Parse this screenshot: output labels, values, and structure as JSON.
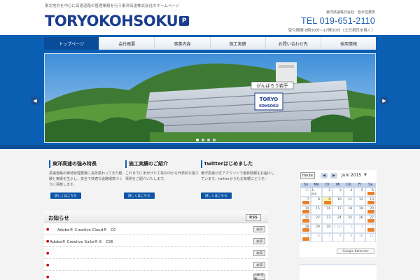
{
  "header": {
    "tagline": "東北地方を中心に高速道路の管理業務を行う東洋高速株式会社のホームページ",
    "logo_text": "TORYOKOHSOKU",
    "logo_mark": "P",
    "company_line": "東洋高速株式会社　岩手営業所",
    "tel": "TEL 019-651-2110",
    "hours": "受付時間 8時30分~17時30分（土日祝日を除く）"
  },
  "nav": {
    "items": [
      "トップページ",
      "会社概要",
      "事業内容",
      "施工実績",
      "お問い合わせ先",
      "採用情報"
    ]
  },
  "slider": {
    "sign_text": "がんばろう岩手",
    "building_logo_line1": "TORYO",
    "building_logo_line2": "KOHSOKU"
  },
  "boxes": [
    {
      "title": "東洋高速の強み特長",
      "text": "高速道路の維持管理業務に長年携わってきた経験と実績を生かし、安全で快適な道路環境づくりに貢献します。",
      "button": "詳しくはこちら"
    },
    {
      "title": "施工実績のご紹介",
      "text": "これまでに手がけた工事の中から代表的な施工事例をご紹介いたします。",
      "button": "詳しくはこちら"
    },
    {
      "title": "twitterはじめました",
      "text": "東洋高速公式アカウントで最新情報をお届けしています。twitterからもお気軽にどうぞ。",
      "button": "詳しくはこちら"
    }
  ],
  "news": {
    "title": "お知らせ",
    "rss_label": "RSS",
    "items": [
      {
        "text": "　　Adobe® Creative Cloud®　CC",
        "badge": "お知"
      },
      {
        "text": "Adobe® Creative Suite® 6　CS6",
        "badge": "お知"
      },
      {
        "text": "",
        "badge": "お知"
      },
      {
        "text": "",
        "badge": "お知"
      },
      {
        "text": "",
        "badge": "CSR活動"
      }
    ]
  },
  "calendar": {
    "today_label": "Heute",
    "prev": "◀",
    "next": "▶",
    "month_label": "Juni 2015",
    "menu_arrow": "▼",
    "weekdays": [
      "So",
      "Mo",
      "Di",
      "Mi",
      "Do",
      "Fr",
      "Sa"
    ],
    "weeks": [
      [
        {
          "d": "31",
          "o": true,
          "e": false
        },
        {
          "d": "1. Jun",
          "o": false,
          "e": false
        },
        {
          "d": "2",
          "o": false,
          "e": false
        },
        {
          "d": "3",
          "o": false,
          "e": false
        },
        {
          "d": "4",
          "o": false,
          "e": false
        },
        {
          "d": "5",
          "o": false,
          "e": false
        },
        {
          "d": "6",
          "o": false,
          "e": true
        }
      ],
      [
        {
          "d": "7",
          "o": false,
          "e": true
        },
        {
          "d": "8",
          "o": false,
          "e": false
        },
        {
          "d": "9",
          "o": false,
          "e": true,
          "t": true
        },
        {
          "d": "10",
          "o": false,
          "e": false
        },
        {
          "d": "11",
          "o": false,
          "e": false
        },
        {
          "d": "12",
          "o": false,
          "e": false
        },
        {
          "d": "13",
          "o": false,
          "e": true
        }
      ],
      [
        {
          "d": "14",
          "o": false,
          "e": true
        },
        {
          "d": "15",
          "o": false,
          "e": false
        },
        {
          "d": "16",
          "o": false,
          "e": false
        },
        {
          "d": "17",
          "o": false,
          "e": false
        },
        {
          "d": "18",
          "o": false,
          "e": false
        },
        {
          "d": "19",
          "o": false,
          "e": false
        },
        {
          "d": "20",
          "o": false,
          "e": true
        }
      ],
      [
        {
          "d": "21",
          "o": false,
          "e": true
        },
        {
          "d": "22",
          "o": false,
          "e": false
        },
        {
          "d": "23",
          "o": false,
          "e": false
        },
        {
          "d": "24",
          "o": false,
          "e": false
        },
        {
          "d": "25",
          "o": false,
          "e": false
        },
        {
          "d": "26",
          "o": false,
          "e": false
        },
        {
          "d": "27",
          "o": false,
          "e": true
        }
      ],
      [
        {
          "d": "28",
          "o": false,
          "e": true
        },
        {
          "d": "29",
          "o": false,
          "e": false
        },
        {
          "d": "30",
          "o": false,
          "e": false
        },
        {
          "d": "1. Jul",
          "o": true,
          "e": false
        },
        {
          "d": "2",
          "o": true,
          "e": false
        },
        {
          "d": "3",
          "o": true,
          "e": false
        },
        {
          "d": "4",
          "o": true,
          "e": true
        }
      ],
      [
        {
          "d": "5",
          "o": true,
          "e": true
        },
        {
          "d": "6",
          "o": true,
          "e": false
        },
        {
          "d": "7",
          "o": true,
          "e": false
        },
        {
          "d": "8",
          "o": true,
          "e": false
        },
        {
          "d": "9",
          "o": true,
          "e": false
        },
        {
          "d": "10",
          "o": true,
          "e": false
        },
        {
          "d": "11",
          "o": true,
          "e": false
        }
      ]
    ],
    "google_label": "Google Kalender"
  },
  "colors": {
    "brand_blue": "#0a5fb3",
    "nav_active": "#0a4c9a",
    "event_orange": "#e9802b",
    "today_yellow": "#fff3a8"
  }
}
